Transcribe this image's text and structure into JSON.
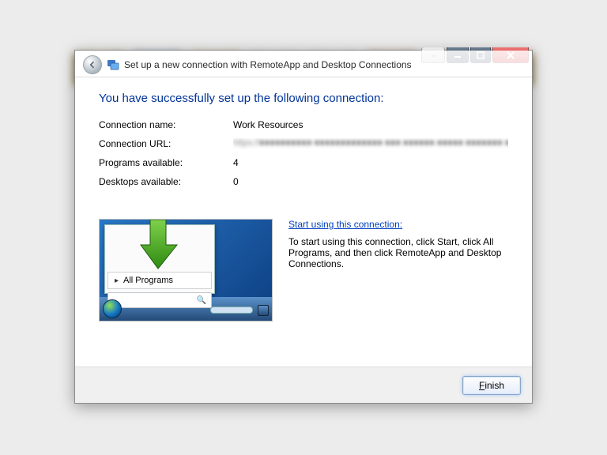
{
  "window": {
    "title": "Set up a new connection with RemoteApp and Desktop Connections"
  },
  "heading": "You have successfully set up the following connection:",
  "fields": {
    "name_label": "Connection name:",
    "name_value": "Work Resources",
    "url_label": "Connection URL:",
    "url_value": "https://■■■■■■■■■■ ■■■■■■■■■■■■■ ■■■ ■■■■■■ ■■■■■ ■■■■■■■ ■■",
    "programs_label": "Programs available:",
    "programs_value": "4",
    "desktops_label": "Desktops available:",
    "desktops_value": "0"
  },
  "illustration": {
    "all_programs": "All Programs",
    "search_icon": "🔍"
  },
  "instruction": {
    "link": "Start using this connection:",
    "text": "To start using this connection, click Start, click All Programs, and then click RemoteApp and Desktop Connections."
  },
  "footer": {
    "finish_u": "F",
    "finish_rest": "inish"
  }
}
